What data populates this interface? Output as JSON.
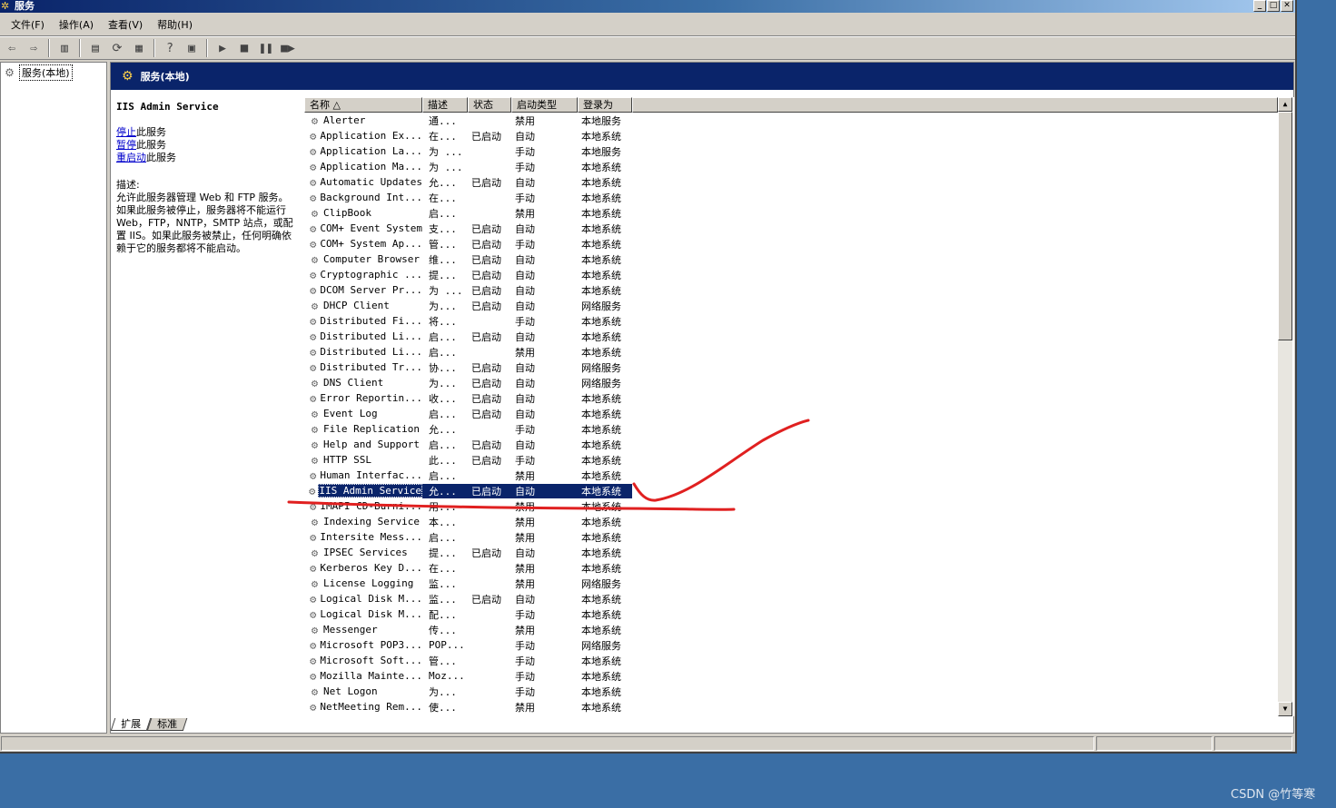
{
  "window": {
    "title": "服务"
  },
  "menu": [
    {
      "name": "menu-file",
      "label": "文件(F)"
    },
    {
      "name": "menu-action",
      "label": "操作(A)"
    },
    {
      "name": "menu-view",
      "label": "查看(V)"
    },
    {
      "name": "menu-help",
      "label": "帮助(H)"
    }
  ],
  "tree": {
    "root_label": "服务(本地)"
  },
  "header": {
    "title": "服务(本地)"
  },
  "details": {
    "service_name": "IIS Admin Service",
    "stop_link": "停止",
    "stop_suffix": "此服务",
    "pause_link": "暂停",
    "pause_suffix": "此服务",
    "restart_link": "重启动",
    "restart_suffix": "此服务",
    "desc_label": "描述:",
    "desc_text": "允许此服务器管理 Web 和 FTP 服务。如果此服务被停止，服务器将不能运行 Web，FTP，NNTP，SMTP 站点，或配置 IIS。如果此服务被禁止，任何明确依赖于它的服务都将不能启动。"
  },
  "columns": [
    "名称 △",
    "描述",
    "状态",
    "启动类型",
    "登录为"
  ],
  "services": [
    {
      "name": "Alerter",
      "desc": "通...",
      "status": "",
      "startup": "禁用",
      "logon": "本地服务"
    },
    {
      "name": "Application Ex...",
      "desc": "在...",
      "status": "已启动",
      "startup": "自动",
      "logon": "本地系统"
    },
    {
      "name": "Application La...",
      "desc": "为 ...",
      "status": "",
      "startup": "手动",
      "logon": "本地服务"
    },
    {
      "name": "Application Ma...",
      "desc": "为 ...",
      "status": "",
      "startup": "手动",
      "logon": "本地系统"
    },
    {
      "name": "Automatic Updates",
      "desc": "允...",
      "status": "已启动",
      "startup": "自动",
      "logon": "本地系统"
    },
    {
      "name": "Background Int...",
      "desc": "在...",
      "status": "",
      "startup": "手动",
      "logon": "本地系统"
    },
    {
      "name": "ClipBook",
      "desc": "启...",
      "status": "",
      "startup": "禁用",
      "logon": "本地系统"
    },
    {
      "name": "COM+ Event System",
      "desc": "支...",
      "status": "已启动",
      "startup": "自动",
      "logon": "本地系统"
    },
    {
      "name": "COM+ System Ap...",
      "desc": "管...",
      "status": "已启动",
      "startup": "手动",
      "logon": "本地系统"
    },
    {
      "name": "Computer Browser",
      "desc": "维...",
      "status": "已启动",
      "startup": "自动",
      "logon": "本地系统"
    },
    {
      "name": "Cryptographic ...",
      "desc": "提...",
      "status": "已启动",
      "startup": "自动",
      "logon": "本地系统"
    },
    {
      "name": "DCOM Server Pr...",
      "desc": "为 ...",
      "status": "已启动",
      "startup": "自动",
      "logon": "本地系统"
    },
    {
      "name": "DHCP Client",
      "desc": "为...",
      "status": "已启动",
      "startup": "自动",
      "logon": "网络服务"
    },
    {
      "name": "Distributed Fi...",
      "desc": "将...",
      "status": "",
      "startup": "手动",
      "logon": "本地系统"
    },
    {
      "name": "Distributed Li...",
      "desc": "启...",
      "status": "已启动",
      "startup": "自动",
      "logon": "本地系统"
    },
    {
      "name": "Distributed Li...",
      "desc": "启...",
      "status": "",
      "startup": "禁用",
      "logon": "本地系统"
    },
    {
      "name": "Distributed Tr...",
      "desc": "协...",
      "status": "已启动",
      "startup": "自动",
      "logon": "网络服务"
    },
    {
      "name": "DNS Client",
      "desc": "为...",
      "status": "已启动",
      "startup": "自动",
      "logon": "网络服务"
    },
    {
      "name": "Error Reportin...",
      "desc": "收...",
      "status": "已启动",
      "startup": "自动",
      "logon": "本地系统"
    },
    {
      "name": "Event Log",
      "desc": "启...",
      "status": "已启动",
      "startup": "自动",
      "logon": "本地系统"
    },
    {
      "name": "File Replication",
      "desc": "允...",
      "status": "",
      "startup": "手动",
      "logon": "本地系统"
    },
    {
      "name": "Help and Support",
      "desc": "启...",
      "status": "已启动",
      "startup": "自动",
      "logon": "本地系统"
    },
    {
      "name": "HTTP SSL",
      "desc": "此...",
      "status": "已启动",
      "startup": "手动",
      "logon": "本地系统"
    },
    {
      "name": "Human Interfac...",
      "desc": "启...",
      "status": "",
      "startup": "禁用",
      "logon": "本地系统"
    },
    {
      "name": "IIS Admin Service",
      "desc": "允...",
      "status": "已启动",
      "startup": "自动",
      "logon": "本地系统",
      "selected": true
    },
    {
      "name": "IMAPI CD-Burni...",
      "desc": "用...",
      "status": "",
      "startup": "禁用",
      "logon": "本地系统"
    },
    {
      "name": "Indexing Service",
      "desc": "本...",
      "status": "",
      "startup": "禁用",
      "logon": "本地系统"
    },
    {
      "name": "Intersite Mess...",
      "desc": "启...",
      "status": "",
      "startup": "禁用",
      "logon": "本地系统"
    },
    {
      "name": "IPSEC Services",
      "desc": "提...",
      "status": "已启动",
      "startup": "自动",
      "logon": "本地系统"
    },
    {
      "name": "Kerberos Key D...",
      "desc": "在...",
      "status": "",
      "startup": "禁用",
      "logon": "本地系统"
    },
    {
      "name": "License Logging",
      "desc": "监...",
      "status": "",
      "startup": "禁用",
      "logon": "网络服务"
    },
    {
      "name": "Logical Disk M...",
      "desc": "监...",
      "status": "已启动",
      "startup": "自动",
      "logon": "本地系统"
    },
    {
      "name": "Logical Disk M...",
      "desc": "配...",
      "status": "",
      "startup": "手动",
      "logon": "本地系统"
    },
    {
      "name": "Messenger",
      "desc": "传...",
      "status": "",
      "startup": "禁用",
      "logon": "本地系统"
    },
    {
      "name": "Microsoft POP3...",
      "desc": "POP...",
      "status": "",
      "startup": "手动",
      "logon": "网络服务"
    },
    {
      "name": "Microsoft Soft...",
      "desc": "管...",
      "status": "",
      "startup": "手动",
      "logon": "本地系统"
    },
    {
      "name": "Mozilla Mainte...",
      "desc": "Moz...",
      "status": "",
      "startup": "手动",
      "logon": "本地系统"
    },
    {
      "name": "Net Logon",
      "desc": "为...",
      "status": "",
      "startup": "手动",
      "logon": "本地系统"
    },
    {
      "name": "NetMeeting Rem...",
      "desc": "使...",
      "status": "",
      "startup": "禁用",
      "logon": "本地系统"
    }
  ],
  "tabs": [
    "扩展",
    "标准"
  ],
  "watermark": "CSDN @竹等寒",
  "annotation_color": "#e02020"
}
